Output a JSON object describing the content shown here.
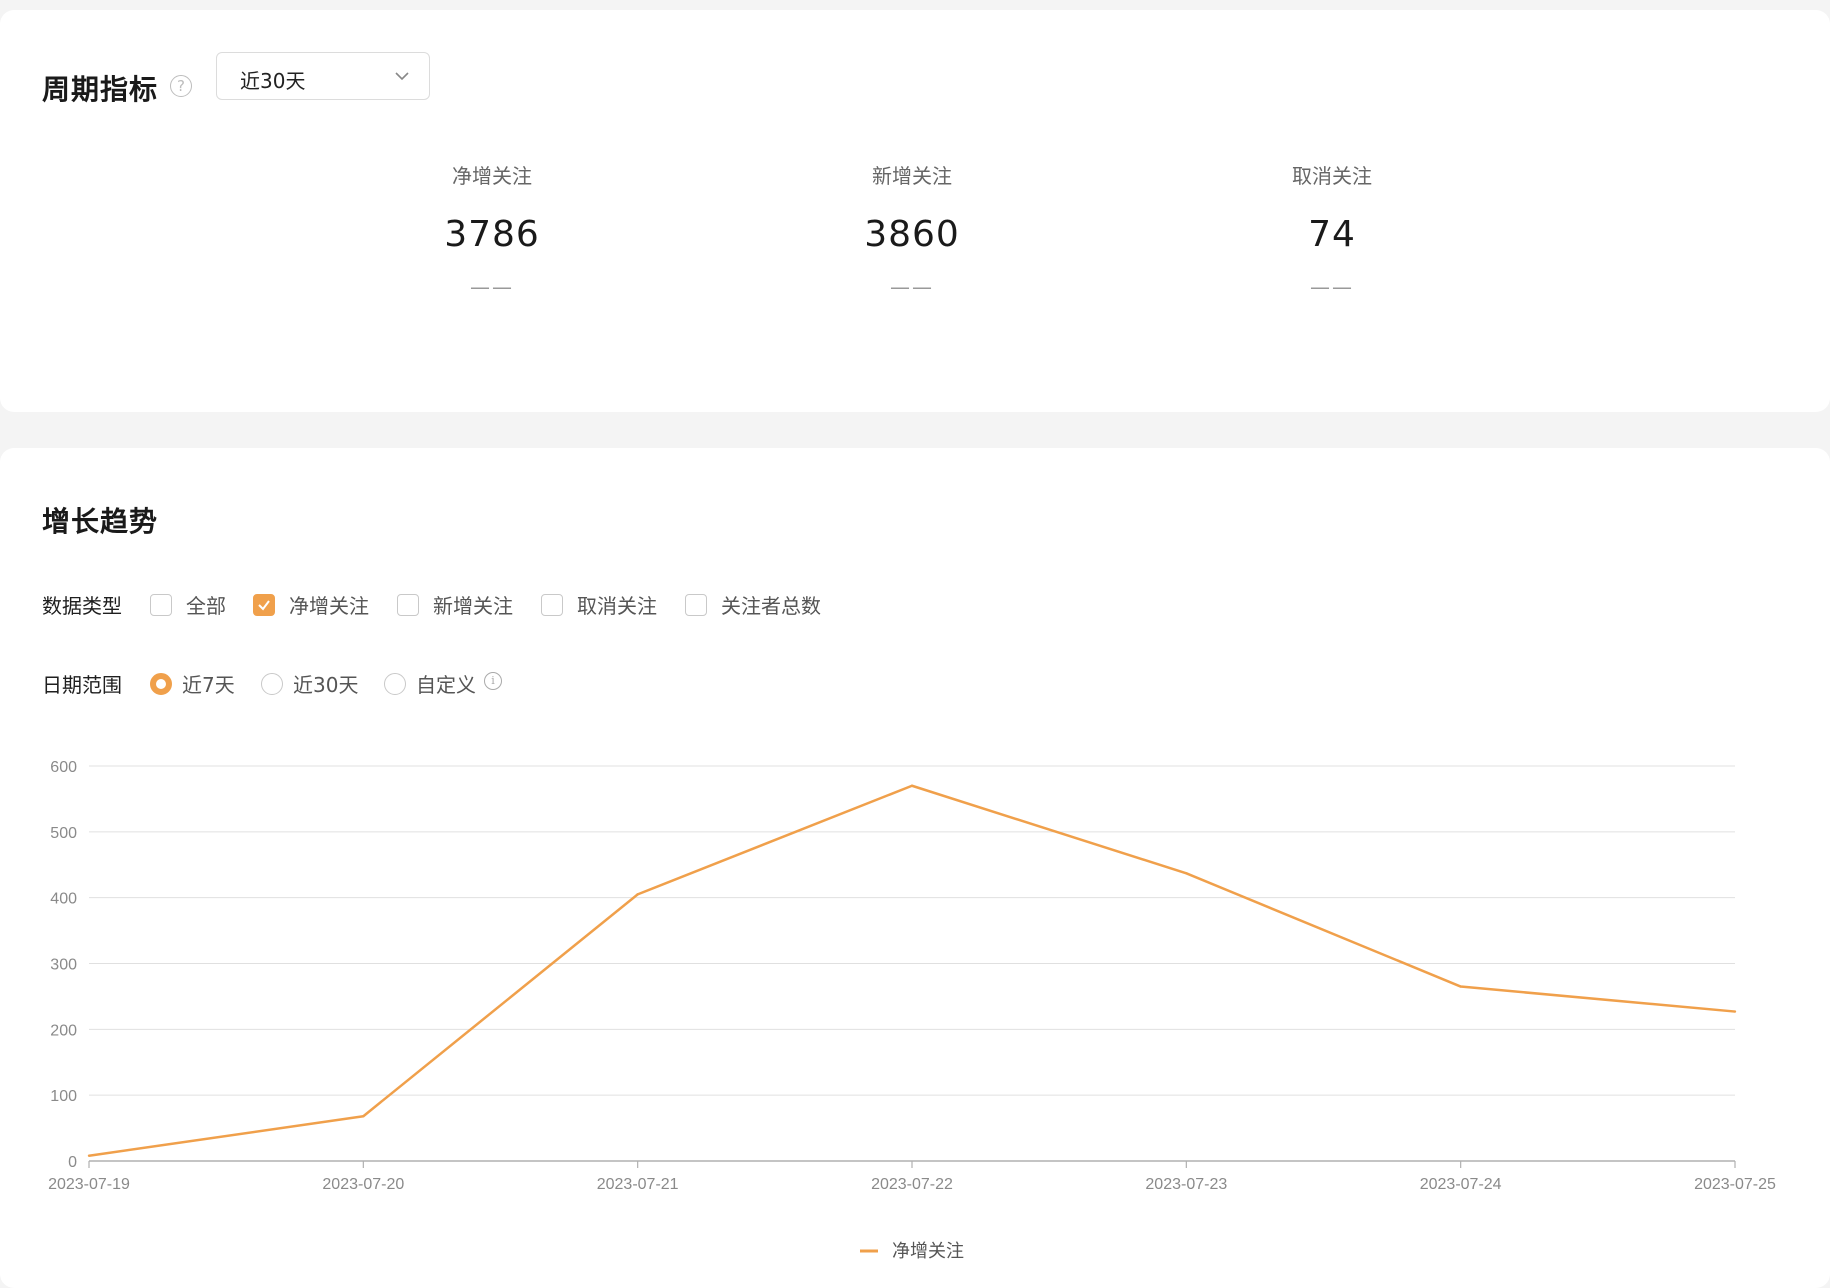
{
  "period": {
    "title": "周期指标",
    "help_icon": "question-circle-icon",
    "select_value": "近30天",
    "metrics": [
      {
        "label": "净增关注",
        "value": "3786",
        "delta": "——"
      },
      {
        "label": "新增关注",
        "value": "3860",
        "delta": "——"
      },
      {
        "label": "取消关注",
        "value": "74",
        "delta": "——"
      }
    ]
  },
  "trend": {
    "title": "增长趋势",
    "data_type_label": "数据类型",
    "data_types": [
      {
        "label": "全部",
        "checked": false
      },
      {
        "label": "净增关注",
        "checked": true
      },
      {
        "label": "新增关注",
        "checked": false
      },
      {
        "label": "取消关注",
        "checked": false
      },
      {
        "label": "关注者总数",
        "checked": false
      }
    ],
    "date_range_label": "日期范围",
    "date_ranges": [
      {
        "label": "近7天",
        "selected": true
      },
      {
        "label": "近30天",
        "selected": false
      },
      {
        "label": "自定义",
        "selected": false
      }
    ],
    "info_icon": "info-circle-icon"
  },
  "colors": {
    "accent": "#f0a04b",
    "grid": "#e0e0e0",
    "axis": "#b0b0b0"
  },
  "chart_data": {
    "type": "line",
    "x": [
      "2023-07-19",
      "2023-07-20",
      "2023-07-21",
      "2023-07-22",
      "2023-07-23",
      "2023-07-24",
      "2023-07-25"
    ],
    "series": [
      {
        "name": "净增关注",
        "values": [
          8,
          68,
          405,
          570,
          437,
          265,
          227
        ]
      }
    ],
    "ylim": [
      0,
      600
    ],
    "yticks": [
      0,
      100,
      200,
      300,
      400,
      500,
      600
    ],
    "grid": true,
    "legend": "bottom-center"
  }
}
